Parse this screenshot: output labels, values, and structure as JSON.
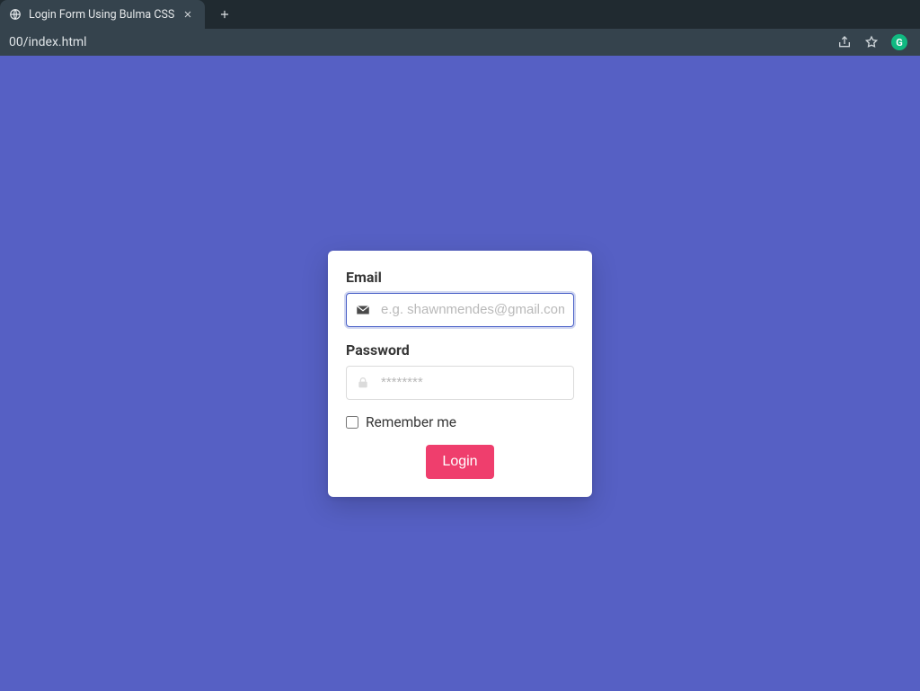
{
  "browser": {
    "tab_title": "Login Form Using Bulma CSS",
    "address": "00/index.html",
    "extension_badge": "G"
  },
  "form": {
    "email": {
      "label": "Email",
      "placeholder": "e.g. shawnmendes@gmail.com",
      "value": ""
    },
    "password": {
      "label": "Password",
      "placeholder": "********",
      "value": ""
    },
    "remember_label": "Remember me",
    "login_label": "Login"
  },
  "colors": {
    "page_bg": "#5660c4",
    "primary_button": "#ef3e6d",
    "focus_ring": "#485fc7"
  }
}
